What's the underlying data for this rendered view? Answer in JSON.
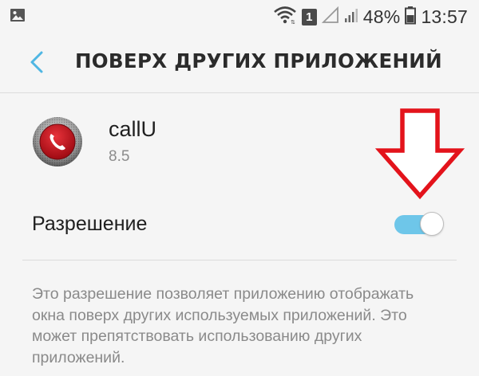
{
  "status_bar": {
    "icons": [
      "image-notification-icon",
      "wifi-icon",
      "sim-badge",
      "signal-outline-icon",
      "signal-icon",
      "battery-icon"
    ],
    "sim_slot": "1",
    "battery_percent": "48%",
    "time": "13:57"
  },
  "header": {
    "back_icon": "chevron-left-icon",
    "title": "ПОВЕРХ ДРУГИХ ПРИЛОЖЕНИЙ"
  },
  "app": {
    "name": "callU",
    "version": "8.5",
    "icon": "phone-record-icon"
  },
  "permission": {
    "label": "Разрешение",
    "enabled": true
  },
  "description": "Это разрешение позволяет приложению отображать окна поверх других используемых приложений. Это может препятствовать использованию других приложений.",
  "colors": {
    "background": "#f5f5f5",
    "accent": "#4fb6e3",
    "toggle_track": "#6ec6e9",
    "annotation_red": "#e3131b",
    "app_icon_red": "#c8101a",
    "secondary_text": "#8a8a8a"
  }
}
